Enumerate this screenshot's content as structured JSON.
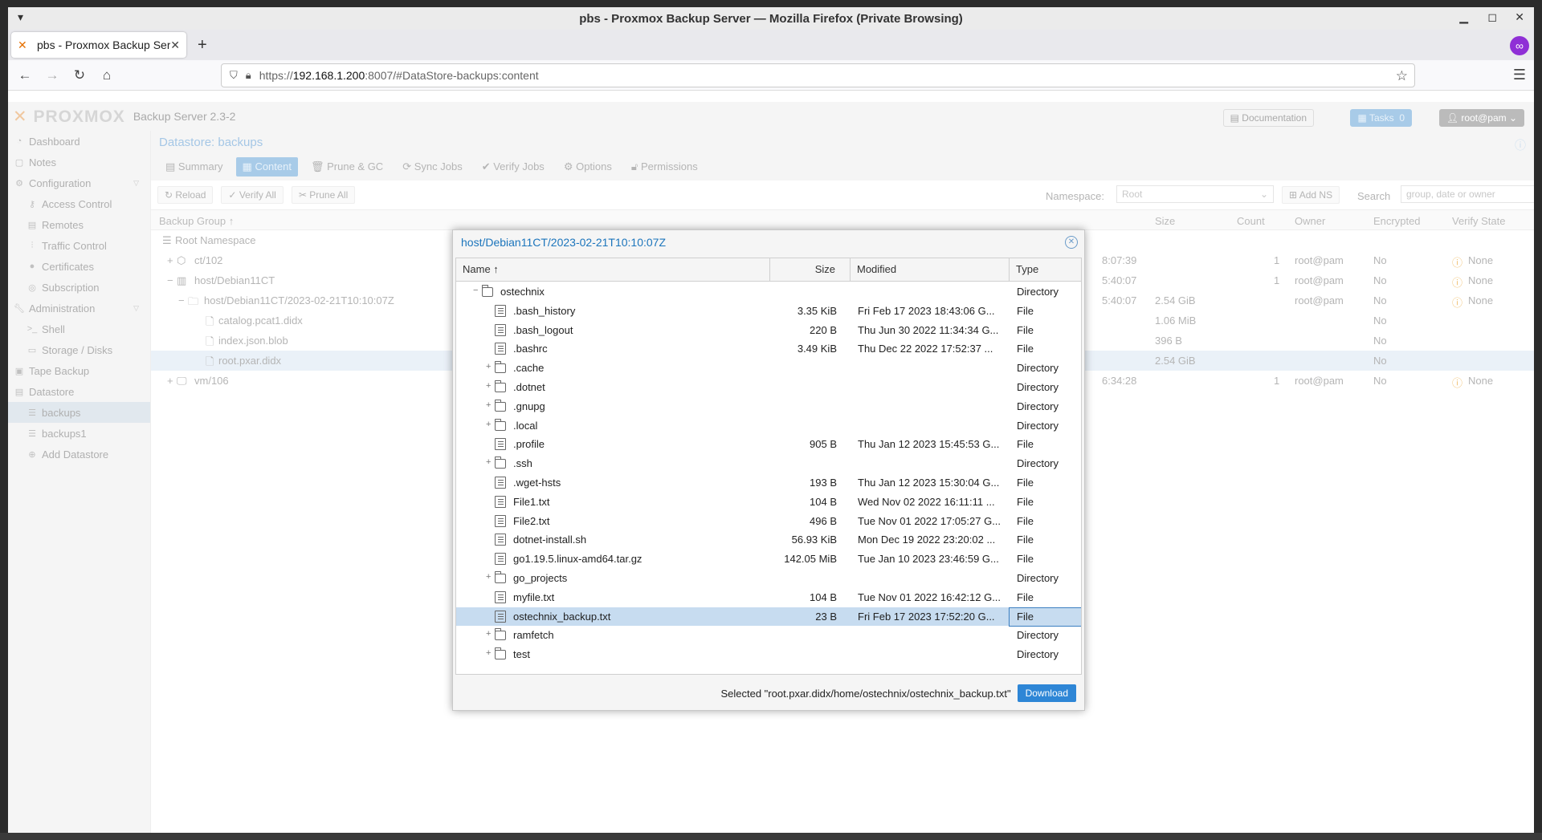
{
  "browser": {
    "window_title": "pbs - Proxmox Backup Server — Mozilla Firefox (Private Browsing)",
    "tab_title": "pbs - Proxmox Backup Serve",
    "url_prefix": "https://",
    "url_host": "192.168.1.200",
    "url_rest": ":8007/#DataStore-backups:content"
  },
  "app": {
    "logo": "PROXMOX",
    "version": "Backup Server 2.3-2",
    "documentation": "Documentation",
    "tasks": "Tasks",
    "tasks_count": "0",
    "user": "root@pam"
  },
  "sidebar": {
    "items": [
      {
        "label": "Dashboard"
      },
      {
        "label": "Notes"
      },
      {
        "label": "Configuration"
      },
      {
        "label": "Access Control"
      },
      {
        "label": "Remotes"
      },
      {
        "label": "Traffic Control"
      },
      {
        "label": "Certificates"
      },
      {
        "label": "Subscription"
      },
      {
        "label": "Administration"
      },
      {
        "label": "Shell"
      },
      {
        "label": "Storage / Disks"
      },
      {
        "label": "Tape Backup"
      },
      {
        "label": "Datastore"
      },
      {
        "label": "backups"
      },
      {
        "label": "backups1"
      },
      {
        "label": "Add Datastore"
      }
    ]
  },
  "datastore": {
    "title": "Datastore: backups",
    "tabs": [
      "Summary",
      "Content",
      "Prune & GC",
      "Sync Jobs",
      "Verify Jobs",
      "Options",
      "Permissions"
    ],
    "toolbar": {
      "reload": "Reload",
      "verify_all": "Verify All",
      "prune_all": "Prune All",
      "namespace_label": "Namespace:",
      "namespace_value": "Root",
      "add_ns": "Add NS",
      "search_label": "Search",
      "search_placeholder": "group, date or owner"
    },
    "columns": [
      "Backup Group ↑",
      "Size",
      "Count",
      "Owner",
      "Encrypted",
      "Verify State"
    ],
    "rows": [
      {
        "name": "Root Namespace",
        "date": "",
        "size": "",
        "count": "",
        "owner": "",
        "enc": "",
        "verify": ""
      },
      {
        "name": "ct/102",
        "date": "8:07:39",
        "size": "",
        "count": "1",
        "owner": "root@pam",
        "enc": "No",
        "verify": "None"
      },
      {
        "name": "host/Debian11CT",
        "date": "5:40:07",
        "size": "",
        "count": "1",
        "owner": "root@pam",
        "enc": "No",
        "verify": "None"
      },
      {
        "name": "host/Debian11CT/2023-02-21T10:10:07Z",
        "date": "5:40:07",
        "size": "2.54 GiB",
        "count": "",
        "owner": "root@pam",
        "enc": "No",
        "verify": "None"
      },
      {
        "name": "catalog.pcat1.didx",
        "date": "",
        "size": "1.06 MiB",
        "count": "",
        "owner": "",
        "enc": "No",
        "verify": ""
      },
      {
        "name": "index.json.blob",
        "date": "",
        "size": "396 B",
        "count": "",
        "owner": "",
        "enc": "No",
        "verify": ""
      },
      {
        "name": "root.pxar.didx",
        "date": "",
        "size": "2.54 GiB",
        "count": "",
        "owner": "",
        "enc": "No",
        "verify": ""
      },
      {
        "name": "vm/106",
        "date": "6:34:28",
        "size": "",
        "count": "1",
        "owner": "root@pam",
        "enc": "No",
        "verify": "None"
      }
    ]
  },
  "dialog": {
    "title": "host/Debian11CT/2023-02-21T10:10:07Z",
    "columns": {
      "name": "Name ↑",
      "size": "Size",
      "modified": "Modified",
      "type": "Type"
    },
    "rows": [
      {
        "name": "ostechnix",
        "size": "",
        "modified": "",
        "type": "Directory"
      },
      {
        "name": ".bash_history",
        "size": "3.35 KiB",
        "modified": "Fri Feb 17 2023 18:43:06 G...",
        "type": "File"
      },
      {
        "name": ".bash_logout",
        "size": "220 B",
        "modified": "Thu Jun 30 2022 11:34:34 G...",
        "type": "File"
      },
      {
        "name": ".bashrc",
        "size": "3.49 KiB",
        "modified": "Thu Dec 22 2022 17:52:37 ...",
        "type": "File"
      },
      {
        "name": ".cache",
        "size": "",
        "modified": "",
        "type": "Directory"
      },
      {
        "name": ".dotnet",
        "size": "",
        "modified": "",
        "type": "Directory"
      },
      {
        "name": ".gnupg",
        "size": "",
        "modified": "",
        "type": "Directory"
      },
      {
        "name": ".local",
        "size": "",
        "modified": "",
        "type": "Directory"
      },
      {
        "name": ".profile",
        "size": "905 B",
        "modified": "Thu Jan 12 2023 15:45:53 G...",
        "type": "File"
      },
      {
        "name": ".ssh",
        "size": "",
        "modified": "",
        "type": "Directory"
      },
      {
        "name": ".wget-hsts",
        "size": "193 B",
        "modified": "Thu Jan 12 2023 15:30:04 G...",
        "type": "File"
      },
      {
        "name": "File1.txt",
        "size": "104 B",
        "modified": "Wed Nov 02 2022 16:11:11 ...",
        "type": "File"
      },
      {
        "name": "File2.txt",
        "size": "496 B",
        "modified": "Tue Nov 01 2022 17:05:27 G...",
        "type": "File"
      },
      {
        "name": "dotnet-install.sh",
        "size": "56.93 KiB",
        "modified": "Mon Dec 19 2022 23:20:02 ...",
        "type": "File"
      },
      {
        "name": "go1.19.5.linux-amd64.tar.gz",
        "size": "142.05 MiB",
        "modified": "Tue Jan 10 2023 23:46:59 G...",
        "type": "File"
      },
      {
        "name": "go_projects",
        "size": "",
        "modified": "",
        "type": "Directory"
      },
      {
        "name": "myfile.txt",
        "size": "104 B",
        "modified": "Tue Nov 01 2022 16:42:12 G...",
        "type": "File"
      },
      {
        "name": "ostechnix_backup.txt",
        "size": "23 B",
        "modified": "Fri Feb 17 2023 17:52:20 G...",
        "type": "File"
      },
      {
        "name": "ramfetch",
        "size": "",
        "modified": "",
        "type": "Directory"
      },
      {
        "name": "test",
        "size": "",
        "modified": "",
        "type": "Directory"
      }
    ],
    "selected_text": "Selected \"root.pxar.didx/home/ostechnix/ostechnix_backup.txt\"",
    "download": "Download"
  }
}
